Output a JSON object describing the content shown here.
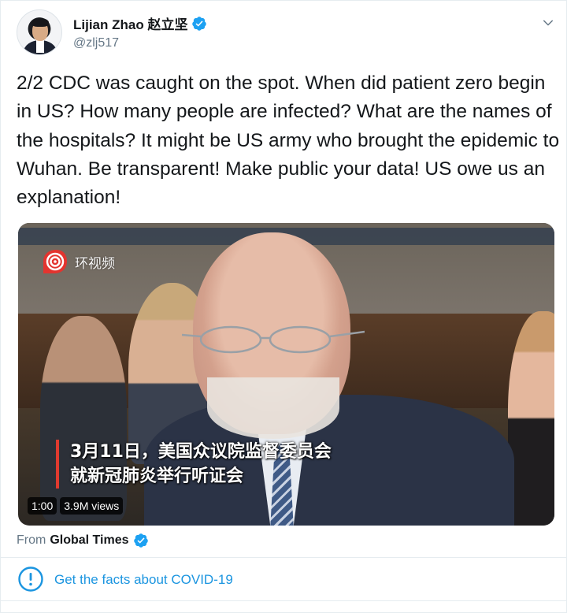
{
  "colors": {
    "accent": "#1b95e0",
    "text": "#14171a",
    "muted": "#657786",
    "caption_bar": "#e03a2f"
  },
  "author": {
    "display_name": "Lijian Zhao 赵立坚",
    "handle": "@zlj517",
    "verified": true
  },
  "icons": {
    "avatar": "avatar",
    "verified": "verified-badge-icon",
    "caret": "chevron-down-icon",
    "info": "info-circle-icon",
    "source": "huanshipin-logo"
  },
  "tweet": {
    "text": "2/2 CDC was caught on the spot. When did patient zero begin in US? How many people are infected? What are the names of the hospitals? It might be US army who brought the epidemic to Wuhan. Be transparent! Make public your data! US owe us an explanation!"
  },
  "video": {
    "source_label": "环视频",
    "caption_line1": "3月11日，美国众议院监督委员会",
    "caption_line2": "就新冠肺炎举行听证会",
    "duration": "1:00",
    "views": "3.9M views"
  },
  "attribution": {
    "prefix": "From",
    "source_name": "Global Times",
    "verified": true
  },
  "facts_card": {
    "label": "Get the facts about COVID-19"
  }
}
